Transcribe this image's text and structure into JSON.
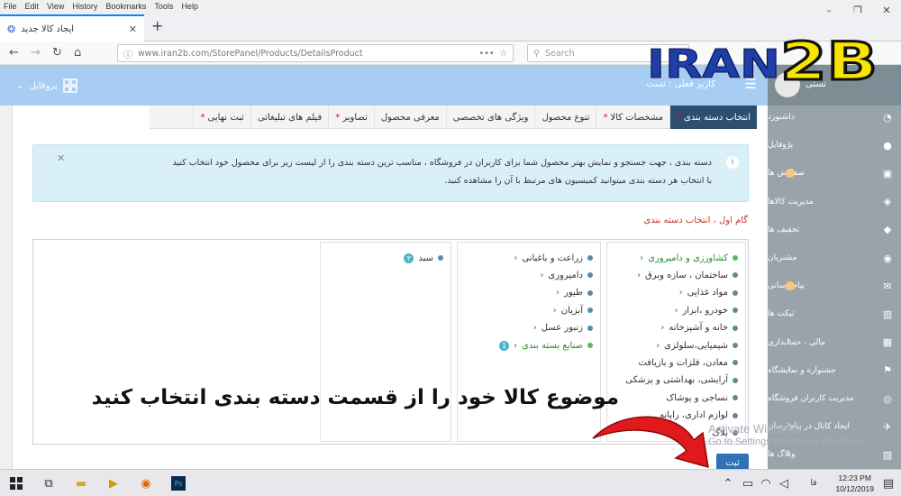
{
  "browser": {
    "menu": [
      "File",
      "Edit",
      "View",
      "History",
      "Bookmarks",
      "Tools",
      "Help"
    ],
    "tab_title": "ایجاد کالا جدید",
    "url": "www.iran2b.com/StorePanel/Products/DetailsProduct",
    "search_placeholder": "Search",
    "url_actions": "•••"
  },
  "logo_text": "IRAN2B",
  "header": {
    "profile_label": "پروفایل",
    "current_user": "کاربر فعلی : تست",
    "sidebar_username": "تستی"
  },
  "sidebar": {
    "items": [
      {
        "label": "داشبورد",
        "icon": "dashboard-icon",
        "has_chevron": false,
        "has_dot": false
      },
      {
        "label": "پروفایل",
        "icon": "user-icon",
        "has_chevron": true,
        "has_dot": false
      },
      {
        "label": "سفارش ها",
        "icon": "cart-icon",
        "has_chevron": false,
        "has_dot": true
      },
      {
        "label": "مدیریت کالاها",
        "icon": "box-icon",
        "has_chevron": false,
        "has_dot": false
      },
      {
        "label": "تخفیف ها",
        "icon": "tag-icon",
        "has_chevron": false,
        "has_dot": false
      },
      {
        "label": "مشتریان",
        "icon": "users-icon",
        "has_chevron": false,
        "has_dot": false
      },
      {
        "label": "پیام رسانی",
        "icon": "message-icon",
        "has_chevron": false,
        "has_dot": true
      },
      {
        "label": "تیکت ها",
        "icon": "ticket-icon",
        "has_chevron": false,
        "has_dot": false
      },
      {
        "label": "مالی ، حسابداری",
        "icon": "wallet-icon",
        "has_chevron": true,
        "has_dot": false
      },
      {
        "label": "جشنواره و نمایشگاه",
        "icon": "flag-icon",
        "has_chevron": true,
        "has_dot": false
      },
      {
        "label": "مدیریت کاربران فروشگاه",
        "icon": "user-group-icon",
        "has_chevron": false,
        "has_dot": false
      },
      {
        "label": "ایجاد کانال در پیام رسان",
        "icon": "channel-icon",
        "has_chevron": true,
        "has_dot": false
      },
      {
        "label": "وبلاگ ها",
        "icon": "blog-icon",
        "has_chevron": true,
        "has_dot": false
      }
    ]
  },
  "product_tabs": [
    {
      "label": "انتخاب دسته بندی",
      "required": true,
      "active": true
    },
    {
      "label": "مشخصات کالا",
      "required": true,
      "active": false
    },
    {
      "label": "تنوع محصول",
      "required": false,
      "active": false
    },
    {
      "label": "ویژگی های تخصصی",
      "required": false,
      "active": false
    },
    {
      "label": "معرفی محصول",
      "required": false,
      "active": false
    },
    {
      "label": "تصاویر",
      "required": true,
      "active": false
    },
    {
      "label": "فیلم های تبلیغاتی",
      "required": false,
      "active": false
    },
    {
      "label": "ثبت نهایی",
      "required": true,
      "active": false
    }
  ],
  "alert": {
    "line1": "دسته بندی ، جهت جستجو و نمایش بهتر محصول شما برای کاربران در فروشگاه ، مناسب ترین دسته بندی را از لیست زیر برای محصول خود انتخاب کنید",
    "line2": "با انتخاب هر دسته بندی میتوانید کمیسیون های مرتبط با آن را مشاهده کنید."
  },
  "step_label": "گام اول ، انتخاب دسته بندی",
  "categories": {
    "col1": [
      {
        "label": "کشاورزی و دامپروری",
        "selected": true,
        "chevron": true
      },
      {
        "label": "ساختمان ، سازه وبرق",
        "selected": false,
        "chevron": true
      },
      {
        "label": "مواد غذایی",
        "selected": false,
        "chevron": true
      },
      {
        "label": "خودرو ،ابزار",
        "selected": false,
        "chevron": true
      },
      {
        "label": "خانه و آشپزخانه",
        "selected": false,
        "chevron": true
      },
      {
        "label": "شیمیایی،سلولزی",
        "selected": false,
        "chevron": true
      },
      {
        "label": "معادن، فلزات و بازیافت",
        "selected": false,
        "chevron": false
      },
      {
        "label": "آرایشی، بهداشتی و پزشکی",
        "selected": false,
        "chevron": false
      },
      {
        "label": "نساجی و پوشاک",
        "selected": false,
        "chevron": false
      },
      {
        "label": "لوازم اداری، رایانه",
        "selected": false,
        "chevron": false
      },
      {
        "label": "بلاگ",
        "selected": false,
        "chevron": false
      }
    ],
    "col2": [
      {
        "label": "زراعت و باغبانی",
        "selected": false,
        "chevron": true,
        "badge": ""
      },
      {
        "label": "دامپروری",
        "selected": false,
        "chevron": true,
        "badge": ""
      },
      {
        "label": "طیور",
        "selected": false,
        "chevron": true,
        "badge": ""
      },
      {
        "label": "آبزیان",
        "selected": false,
        "chevron": true,
        "badge": ""
      },
      {
        "label": "زنبور عسل",
        "selected": false,
        "chevron": true,
        "badge": ""
      },
      {
        "label": "صنایع بسته بندی",
        "selected": true,
        "chevron": true,
        "badge": "1"
      }
    ],
    "col3": [
      {
        "label": "سبد",
        "selected": false,
        "chevron": false,
        "badge": "۳"
      }
    ]
  },
  "overlay_instruction": "موضوع کالا خود را از قسمت دسته بندی انتخاب کنید",
  "windows_watermark": {
    "line1": "Activate Windows",
    "line2": "Go to Settings to activate Windows."
  },
  "submit_label": "ثبت",
  "taskbar": {
    "time": "12:23 PM",
    "date": "10/12/2019",
    "lang": "فا"
  },
  "colors": {
    "header": "#a8cdf3",
    "sidebar": "#9aa3a9",
    "active_tab": "#2d4e6f",
    "alert_bg": "#d9f0f8",
    "selected_green": "#5cb85c",
    "arrow_red": "#e0191c",
    "logo_blue": "#1e3ea8",
    "logo_yellow": "#f7e600"
  }
}
